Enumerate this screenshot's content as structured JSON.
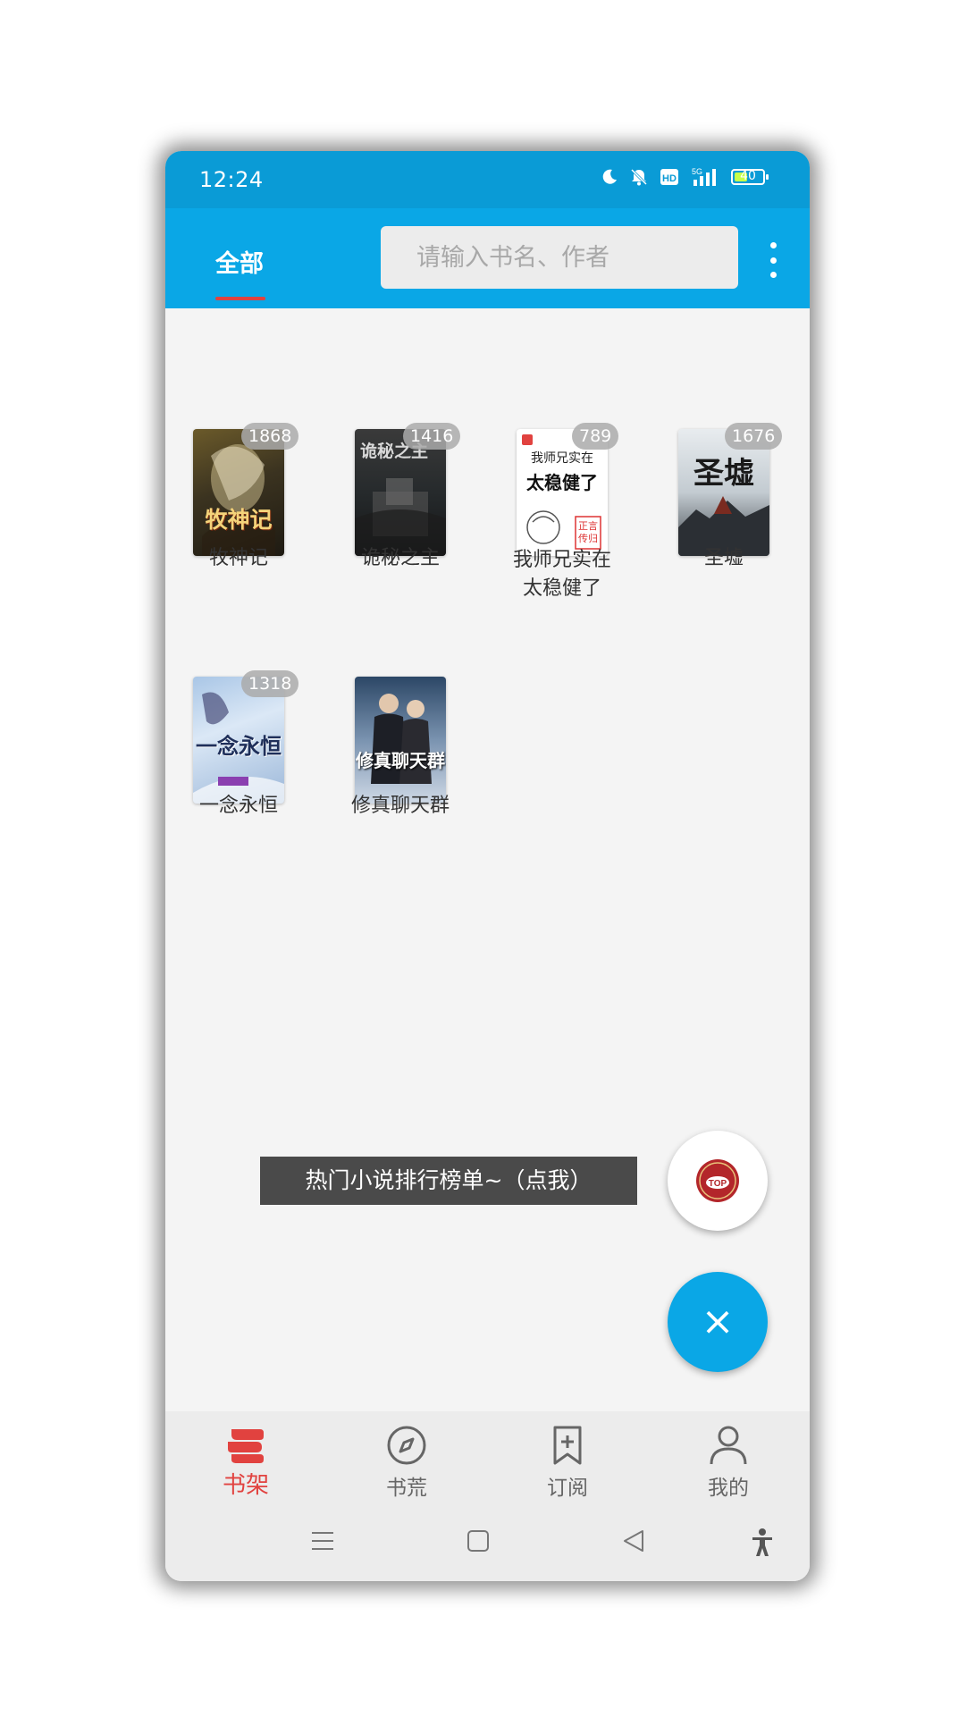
{
  "status_bar": {
    "time": "12:24",
    "network": "5G",
    "battery": "40",
    "icons": [
      "moon-icon",
      "bell-off-icon",
      "hd-icon",
      "signal-icon",
      "battery-icon"
    ]
  },
  "topbar": {
    "tab_all": "全部",
    "search_placeholder": "请输入书名、作者",
    "more_icon": "more-vertical-icon"
  },
  "books": [
    {
      "title": "牧神记",
      "badge": "1868",
      "cover_text": "牧神记"
    },
    {
      "title": "诡秘之主",
      "badge": "1416",
      "cover_text": "诡秘之主"
    },
    {
      "title": "我师兄实在太稳健了",
      "title_line1": "我师兄实在",
      "title_line2": "太稳健了",
      "badge": "789",
      "cover_top": "我师兄实在",
      "cover_main": "太稳健了",
      "cover_small": "正言传归"
    },
    {
      "title": "圣墟",
      "badge": "1676",
      "cover_text": "圣墟"
    },
    {
      "title": "一念永恒",
      "badge": "1318",
      "cover_text": "一念永恒"
    },
    {
      "title": "修真聊天群",
      "badge": "",
      "cover_text": "修真聊天群"
    }
  ],
  "ranking_banner": "热门小说排行榜单~（点我）",
  "fab_top_label": "TOP",
  "fab_close": "×",
  "bottom_nav": [
    {
      "label": "书架",
      "icon": "bookshelf-icon",
      "active": true
    },
    {
      "label": "书荒",
      "icon": "compass-icon",
      "active": false
    },
    {
      "label": "订阅",
      "icon": "bookmark-add-icon",
      "active": false
    },
    {
      "label": "我的",
      "icon": "user-icon",
      "active": false
    }
  ],
  "system_nav": [
    "menu-icon",
    "home-icon",
    "back-icon",
    "accessibility-icon"
  ],
  "colors": {
    "status_bar": "#0a9bd6",
    "topbar": "#0aa7e6",
    "accent": "#e1423f",
    "background": "#f4f4f4"
  }
}
